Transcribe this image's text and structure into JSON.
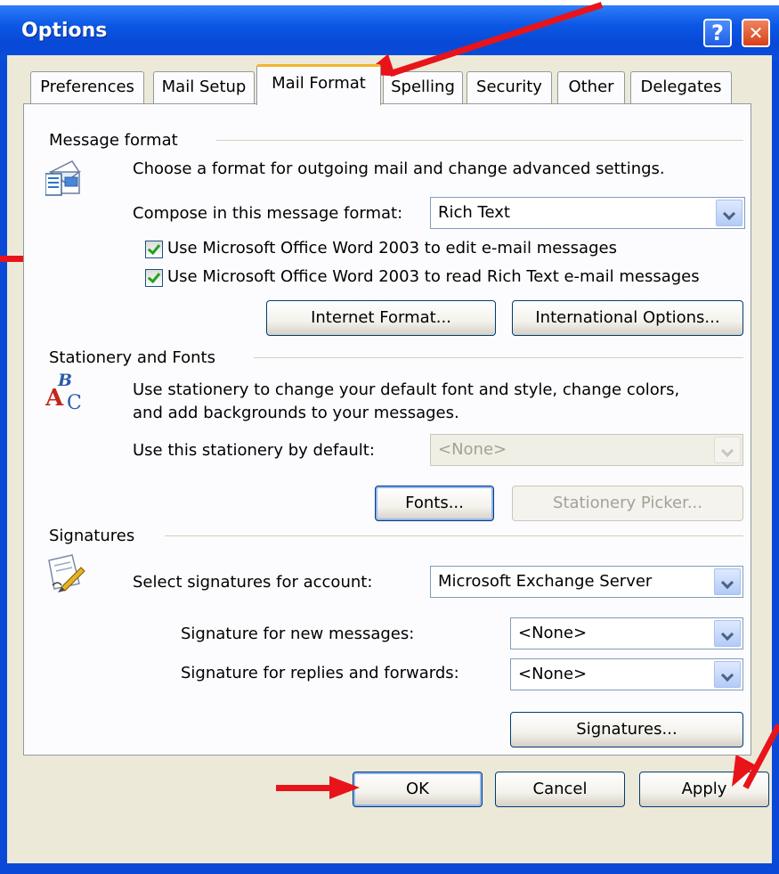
{
  "window": {
    "title": "Options",
    "help_label": "?",
    "close_label": "✕",
    "colors": {
      "titlebar": "#0c58e6",
      "client": "#ece9d8",
      "arrow": "#e8141a",
      "active_tab_accent": "#f2b431"
    }
  },
  "tabs": [
    {
      "label": "Preferences",
      "active": false
    },
    {
      "label": "Mail Setup",
      "active": false
    },
    {
      "label": "Mail Format",
      "active": true
    },
    {
      "label": "Spelling",
      "active": false
    },
    {
      "label": "Security",
      "active": false
    },
    {
      "label": "Other",
      "active": false
    },
    {
      "label": "Delegates",
      "active": false
    }
  ],
  "message_format": {
    "group_label": "Message format",
    "icon": "envelope-document-icon",
    "description": "Choose a format for outgoing mail and change advanced settings.",
    "compose_label": "Compose in this message format:",
    "compose_value": "Rich Text",
    "check_edit": {
      "label": "Use Microsoft Office Word 2003 to edit e-mail messages",
      "checked": true
    },
    "check_read": {
      "label": "Use Microsoft Office Word 2003 to read Rich Text e-mail messages",
      "checked": true
    },
    "internet_format_button": "Internet Format...",
    "international_options_button": "International Options..."
  },
  "stationery": {
    "group_label": "Stationery and Fonts",
    "icon": "abc-fonts-icon",
    "description_line1": "Use stationery to change your default font and style, change colors,",
    "description_line2": "and add backgrounds to your messages.",
    "default_label": "Use this stationery by default:",
    "default_value": "<None>",
    "fonts_button": "Fonts...",
    "stationery_picker_button": "Stationery Picker..."
  },
  "signatures": {
    "group_label": "Signatures",
    "icon": "signature-pen-icon",
    "account_label": "Select signatures for account:",
    "account_value": "Microsoft Exchange Server",
    "new_label": "Signature for new messages:",
    "new_value": "<None>",
    "reply_label": "Signature for replies and forwards:",
    "reply_value": "<None>",
    "signatures_button": "Signatures..."
  },
  "footer": {
    "ok": "OK",
    "cancel": "Cancel",
    "apply": "Apply"
  }
}
